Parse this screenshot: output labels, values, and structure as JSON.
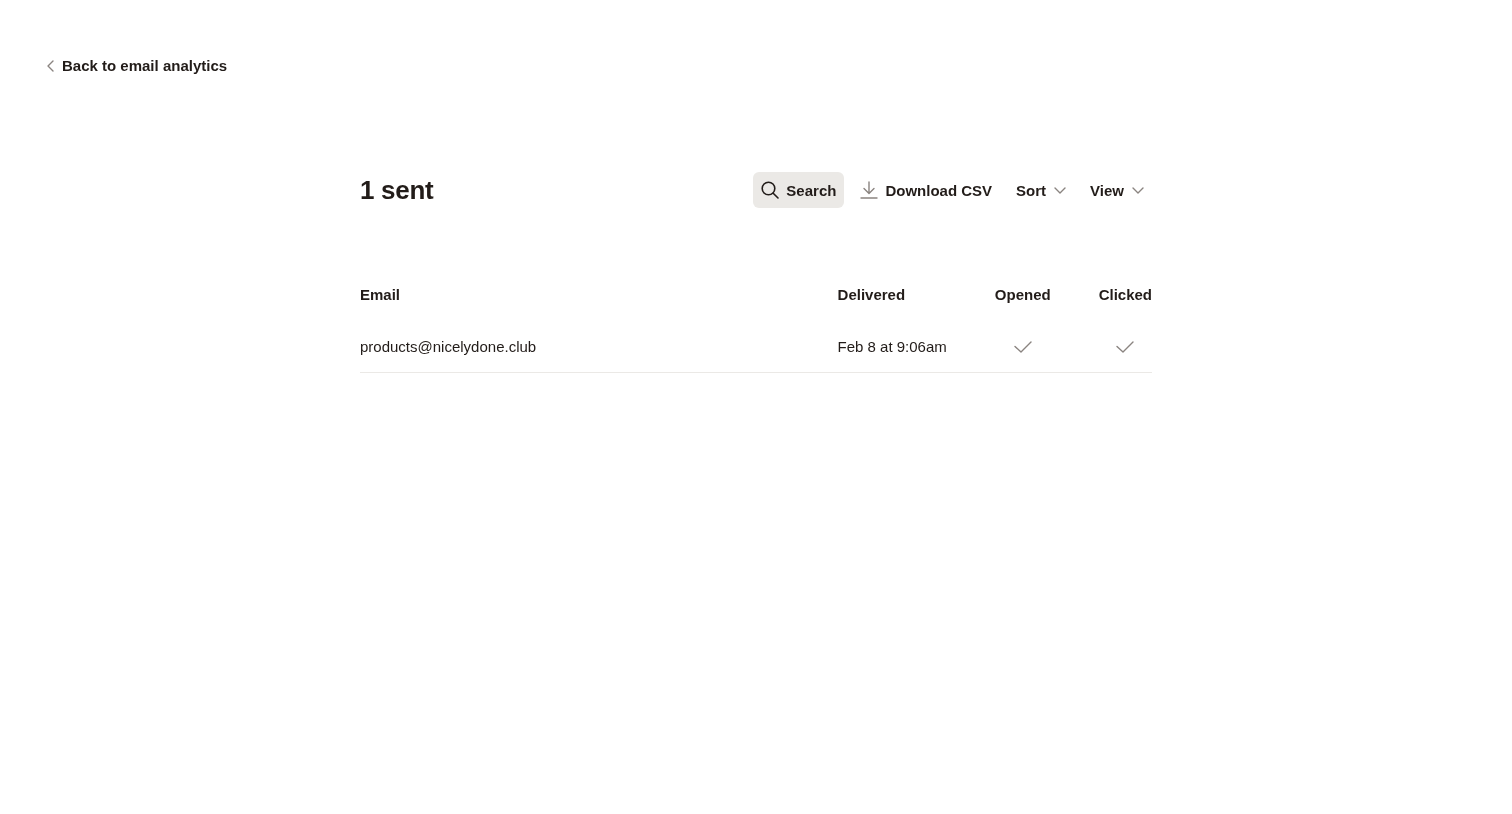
{
  "back_link": {
    "label": "Back to email analytics"
  },
  "header": {
    "title": "1 sent",
    "actions": [
      {
        "kind": "search",
        "label": "Search"
      },
      {
        "kind": "download",
        "label": "Download CSV"
      },
      {
        "kind": "dropdown",
        "label": "Sort"
      },
      {
        "kind": "dropdown",
        "label": "View"
      }
    ]
  },
  "table": {
    "columns": [
      "Email",
      "Delivered",
      "Opened",
      "Clicked"
    ],
    "rows": [
      {
        "email": "products@nicelydone.club",
        "delivered": "Feb 8 at 9:06am",
        "opened": true,
        "clicked": true
      }
    ]
  }
}
